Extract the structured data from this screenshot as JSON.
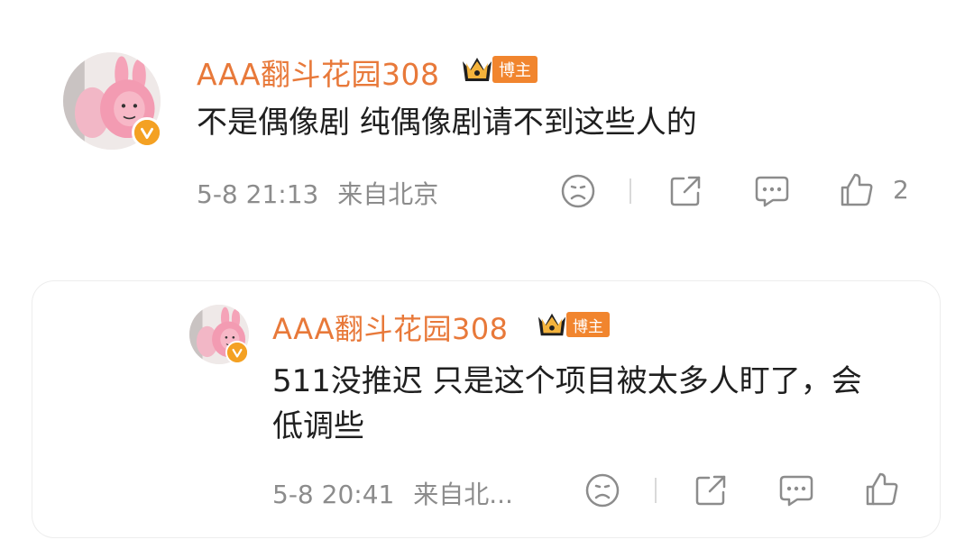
{
  "comment_main": {
    "username": "AAA翻斗花园308",
    "badge_label": "博主",
    "text": "不是偶像剧 纯偶像剧请不到这些人的",
    "time": "5-8 21:13",
    "location": "来自北京",
    "likes": "2"
  },
  "comment_reply": {
    "username": "AAA翻斗花园308",
    "badge_label": "博主",
    "text": "511没推迟 只是这个项目被太多人盯了，会低调些",
    "time": "5-8 20:41",
    "location": "来自北..."
  },
  "colors": {
    "username": "#e8793a",
    "badge_bg": "#f1852e",
    "verified": "#f4a123",
    "meta": "#8c8c8c",
    "content": "#1f1f1f"
  },
  "icons": [
    "frown-icon",
    "share-icon",
    "comment-icon",
    "thumbs-up-icon",
    "crown-icon",
    "verified-icon"
  ]
}
